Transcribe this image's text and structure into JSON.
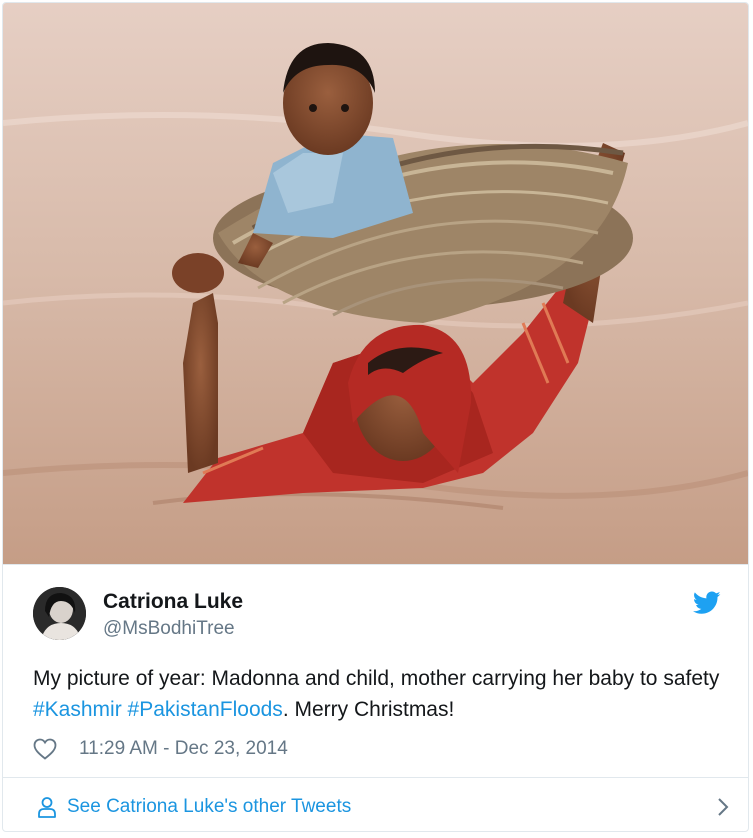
{
  "tweet": {
    "display_name": "Catriona Luke",
    "handle": "@MsBodhiTree",
    "text_prefix": "My picture of year: Madonna and child, mother carrying her baby to safety ",
    "hashtag_1": "#Kashmir",
    "separator": " ",
    "hashtag_2": "#PakistanFloods",
    "text_suffix": ". Merry Christmas!",
    "timestamp": "11:29 AM - Dec 23, 2014",
    "footer_link": "See Catriona Luke's other Tweets"
  },
  "icons": {
    "brand": "twitter-bird-icon",
    "like": "heart-icon",
    "profile": "person-icon",
    "more": "chevron-right-icon"
  },
  "colors": {
    "link": "#1b95e0",
    "secondary_text": "#657786",
    "border": "#e1e8ed"
  }
}
